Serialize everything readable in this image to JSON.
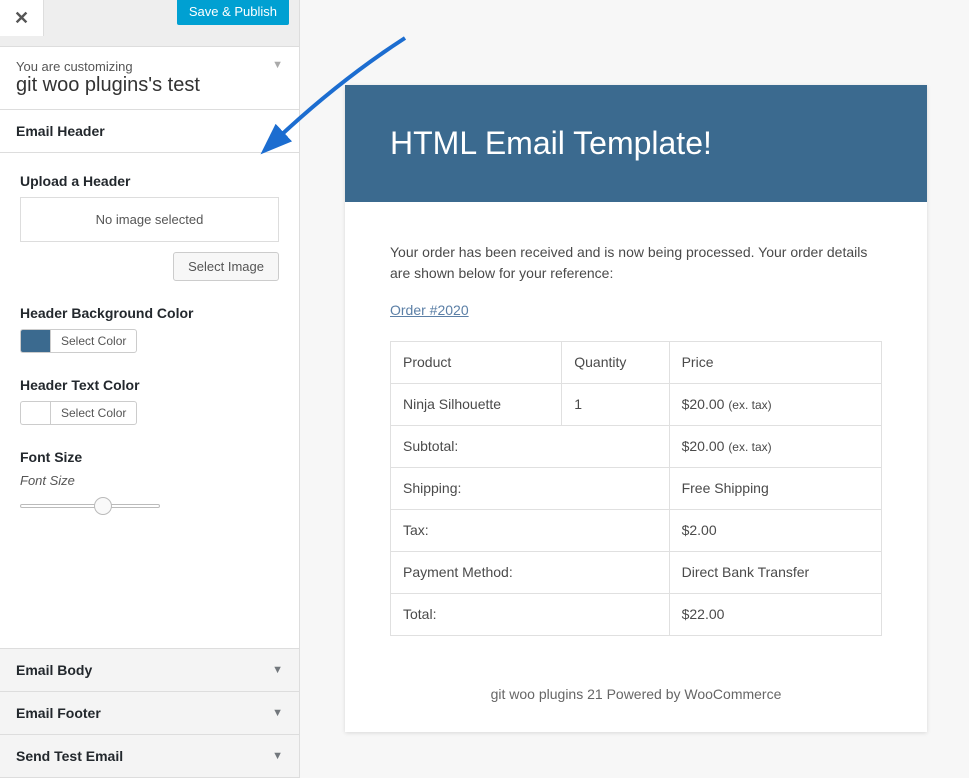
{
  "topbar": {
    "save_label": "Save & Publish"
  },
  "customizing": {
    "label": "You are customizing",
    "site_name": "git woo plugins's test"
  },
  "sections": {
    "email_header": "Email Header",
    "email_body": "Email Body",
    "email_footer": "Email Footer",
    "send_test": "Send Test Email"
  },
  "header_fields": {
    "upload_label": "Upload a Header",
    "no_image": "No image selected",
    "select_image": "Select Image",
    "bg_color_label": "Header Background Color",
    "select_color": "Select Color",
    "text_color_label": "Header Text Color",
    "font_size_label": "Font Size",
    "font_size_sublabel": "Font Size",
    "bg_color_swatch": "#3b6a8f",
    "text_color_swatch": "#ffffff"
  },
  "preview": {
    "title": "HTML Email Template!",
    "intro": "Your order has been received and is now being processed. Your order details are shown below for your reference:",
    "order_link": "Order #2020",
    "table": {
      "headers": {
        "product": "Product",
        "quantity": "Quantity",
        "price": "Price"
      },
      "item": {
        "name": "Ninja Silhouette",
        "qty": "1",
        "price": "$20.00",
        "tax_note": "(ex. tax)"
      },
      "subtotal_label": "Subtotal:",
      "subtotal_value": "$20.00",
      "shipping_label": "Shipping:",
      "shipping_value": "Free Shipping",
      "tax_label": "Tax:",
      "tax_value": "$2.00",
      "payment_label": "Payment Method:",
      "payment_value": "Direct Bank Transfer",
      "total_label": "Total:",
      "total_value": "$22.00"
    },
    "footer": "git woo plugins 21 Powered by WooCommerce"
  }
}
